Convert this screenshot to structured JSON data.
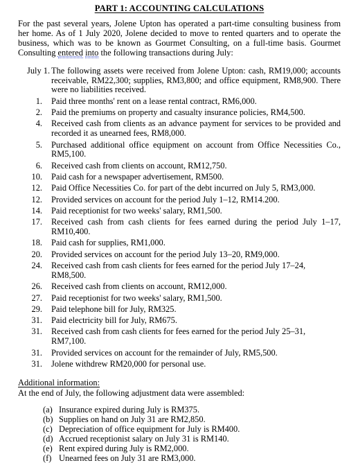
{
  "document": {
    "title": "PART 1: ACCOUNTING CALCULATIONS",
    "intro": {
      "part1": "For the past several years, Jolene Upton has operated a part-time consulting business from her home. As of 1 July 2020, Jolene decided to move to rented quarters and to operate the business, which was to be known as Gourmet Consulting, on a full-time basis. Gourmet Consulting ",
      "flagged_word_1": "entered",
      "part2": " ",
      "flagged_word_2": "into",
      "part3": " the following transactions during July:"
    },
    "transactions": [
      {
        "date": "July 1.",
        "text": "The following assets were received from Jolene Upton: cash, RM19,000; accounts receivable, RM22,300; supplies, RM3,800; and office equipment, RM8,900. There were no liabilities received."
      },
      {
        "date": "1.",
        "text": "Paid three months' rent on a lease rental contract, RM6,000."
      },
      {
        "date": "2.",
        "text": "Paid the premiums on property and casualty insurance policies, RM4,500."
      },
      {
        "date": "4.",
        "text": "Received cash from clients as an advance payment for services to be provided and recorded it as unearned fees, RM8,000."
      },
      {
        "date": "5.",
        "text": "Purchased additional office equipment on account from Office Necessities Co., RM5,100."
      },
      {
        "date": "6.",
        "text": "Received cash from clients on account, RM12,750."
      },
      {
        "date": "10.",
        "text": "Paid cash for a newspaper advertisement, RM500."
      },
      {
        "date": "12.",
        "text": "Paid Office Necessities Co. for part of the debt incurred on July 5, RM3,000."
      },
      {
        "date": "12.",
        "text": "Provided services on account for the period July 1–12, RM14.200."
      },
      {
        "date": "14.",
        "text": "Paid receptionist for two weeks' salary, RM1,500."
      },
      {
        "date": "17.",
        "text": "Received cash from cash clients for fees earned during the period July 1–17, RM10,400."
      },
      {
        "date": "18.",
        "text": "Paid cash for supplies, RM1,000."
      },
      {
        "date": "20.",
        "text": "Provided services on account for the period July 13–20, RM9,000."
      },
      {
        "date": "24.",
        "text": "Received cash from cash clients for fees earned for the period July 17–24, RM8,500."
      },
      {
        "date": "26.",
        "text": "Received cash from clients on account, RM12,000."
      },
      {
        "date": "27.",
        "text": "Paid receptionist for two weeks' salary, RM1,500."
      },
      {
        "date": "29.",
        "text": "Paid telephone bill for July, RM325."
      },
      {
        "date": "31.",
        "text": "Paid electricity bill for July, RM675."
      },
      {
        "date": "31.",
        "text": "Received cash from cash clients for fees earned for the period July 25–31, RM7,100."
      },
      {
        "date": "31.",
        "text": "Provided services on account for the remainder of July, RM5,500."
      },
      {
        "date": "31.",
        "text": "Jolene withdrew RM20,000 for personal use."
      }
    ],
    "additional_information": {
      "heading": "Additional information:",
      "subheading": "At the end of July, the following adjustment data were assembled:",
      "items": [
        {
          "marker": "(a)",
          "text": "Insurance expired during July is RM375."
        },
        {
          "marker": "(b)",
          "text": "Supplies on hand on July 31 are RM2,850."
        },
        {
          "marker": "(c)",
          "text": "Depreciation of office equipment for July is RM400."
        },
        {
          "marker": "(d)",
          "text": "Accrued receptionist salary on July 31 is RM140."
        },
        {
          "marker": "(e)",
          "text": "Rent expired during July is RM2,000."
        },
        {
          "marker": "(f)",
          "text": "Unearned fees on July 31 are RM3,000."
        }
      ]
    }
  }
}
